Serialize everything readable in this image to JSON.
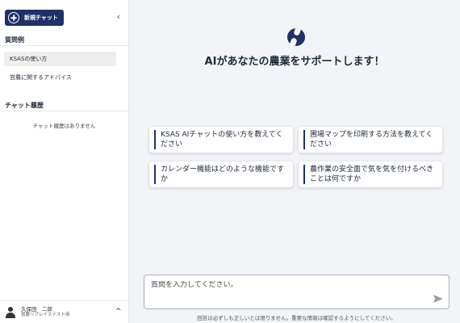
{
  "sidebar": {
    "new_chat_label": "新規チャット",
    "collapse_glyph": "‹",
    "examples_title": "質問例",
    "examples": [
      {
        "label": "KSASの使い方",
        "active": true
      },
      {
        "label": "営農に関するアドバイス",
        "active": false
      }
    ],
    "history_title": "チャット履歴",
    "history_empty": "チャット履歴はありません",
    "user": {
      "name": "久保田　二郎",
      "org": "営農リプレイステスト用",
      "caret": "^"
    }
  },
  "main": {
    "headline": "AIがあなたの農業をサポートします！",
    "suggestions": [
      "KSAS AIチャットの使い方を教えてください",
      "圃場マップを印刷する方法を教えてください",
      "カレンダー機能はどのような機能ですか",
      "農作業の安全面で気を気を付けるべきことは何ですか"
    ],
    "input_placeholder": "質問を入力してください。",
    "disclaimer": "回答は必ずしも正しいとは限りません。重要な情報は確認するようにしてください。"
  },
  "colors": {
    "brand_navy": "#1f3166",
    "background": "#f2f4f7",
    "sidebar_bg": "#ffffff"
  },
  "icons": [
    "plus-circle-icon",
    "chevron-left-icon",
    "user-icon",
    "chevron-up-icon",
    "logo-icon",
    "send-icon"
  ]
}
